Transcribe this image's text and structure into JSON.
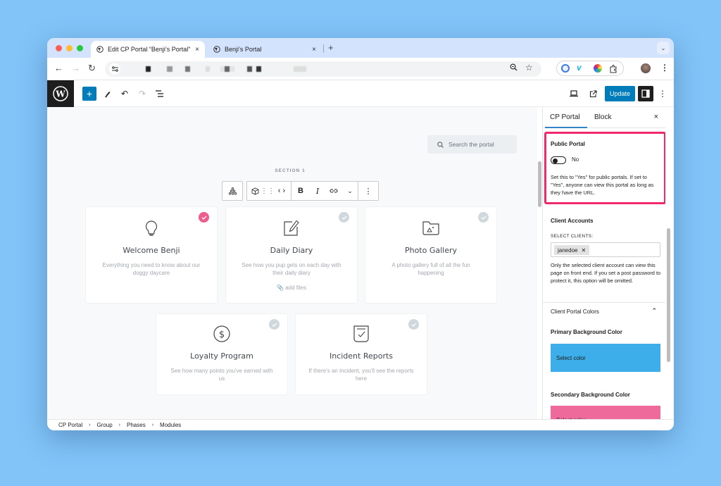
{
  "browser": {
    "tabs": [
      {
        "label": "Edit CP Portal “Benji’s Portal”",
        "active": true
      },
      {
        "label": "Benji’s Portal",
        "active": false
      }
    ],
    "new_tab_label": "+",
    "close_glyph": "×"
  },
  "editor": {
    "update_label": "Update",
    "search_placeholder": "Search the portal",
    "section_label": "SECTION 1",
    "breadcrumb": [
      "CP Portal",
      "Group",
      "Phases",
      "Modules"
    ]
  },
  "cards": [
    {
      "title": "Welcome Benji",
      "desc": "Everything you need to know about our doggy daycare",
      "icon": "lightbulb-icon",
      "checked": true
    },
    {
      "title": "Daily Diary",
      "desc": "See how you pup gets on each day with their daily diary",
      "icon": "edit-note-icon",
      "checked": false,
      "extra": "add files"
    },
    {
      "title": "Photo Gallery",
      "desc": "A photo gallery full of all the fun happening",
      "icon": "photo-folder-icon",
      "checked": false
    },
    {
      "title": "Loyalty Program",
      "desc": "See how many points you've earned with us",
      "icon": "dollar-coin-icon",
      "checked": false
    },
    {
      "title": "Incident Reports",
      "desc": "If there's an incident, you'll see the reports here",
      "icon": "report-check-icon",
      "checked": false
    }
  ],
  "sidebar": {
    "tabs": [
      "CP Portal",
      "Block"
    ],
    "public_portal": {
      "heading": "Public Portal",
      "toggle_value": "No",
      "help": "Set this to \"Yes\" for public portals. If set to \"Yes\", anyone can view this portal as long as they have the URL."
    },
    "client_accounts": {
      "heading": "Client Accounts",
      "select_label": "SELECT CLIENTS:",
      "selected": [
        "janedoe"
      ],
      "help": "Only the selected client account can view this page on front end. If you set a post password to protect it, this option will be omitted."
    },
    "colors": {
      "heading": "Client Portal Colors",
      "primary_label": "Primary Background Color",
      "primary_button": "Select color",
      "primary_color": "#3daee9",
      "secondary_label": "Secondary Background Color",
      "secondary_button": "Select color",
      "secondary_color": "#ee6a9a"
    }
  },
  "colors": {
    "accent": "#007cba",
    "highlight": "#f12a6e",
    "check_active": "#ee5d8e",
    "check_inactive": "#cfd8dc"
  }
}
